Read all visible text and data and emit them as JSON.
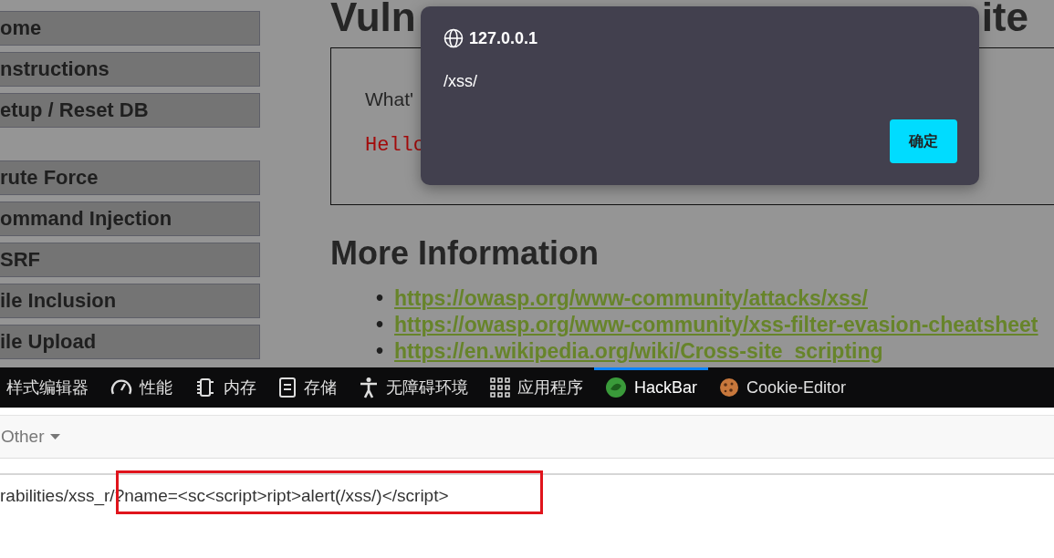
{
  "page": {
    "sidebar_groups": [
      [
        "ome",
        "nstructions",
        "etup / Reset DB"
      ],
      [
        "rute Force",
        "ommand Injection",
        "SRF",
        "ile Inclusion",
        "ile Upload"
      ]
    ],
    "title_parts": [
      "Vuln",
      "ite"
    ],
    "prompt": "What'",
    "greeting": "Hello",
    "more_heading": "More Information",
    "bullet": "•",
    "links": [
      "https://owasp.org/www-community/attacks/xss/",
      "https://owasp.org/www-community/xss-filter-evasion-cheatsheet",
      "https://en.wikipedia.org/wiki/Cross-site_scripting"
    ]
  },
  "dialog": {
    "origin": "127.0.0.1",
    "message": "/xss/",
    "button": "确定"
  },
  "devtools": {
    "tabs": [
      {
        "label": "样式编辑器",
        "kind": "plain",
        "selected": false
      },
      {
        "label": "性能",
        "kind": "gauge",
        "selected": false
      },
      {
        "label": "内存",
        "kind": "chip",
        "selected": false
      },
      {
        "label": "存储",
        "kind": "storage",
        "selected": false
      },
      {
        "label": "无障碍环境",
        "kind": "person",
        "selected": false
      },
      {
        "label": "应用程序",
        "kind": "grid",
        "selected": false
      },
      {
        "label": "HackBar",
        "kind": "hackbar",
        "selected": true
      },
      {
        "label": "Cookie-Editor",
        "kind": "cookie",
        "selected": false
      }
    ]
  },
  "hackbar": {
    "menu": "Other",
    "url": "rabilities/xss_r/?name=<sc<script>ript>alert(/xss/)</script>"
  }
}
